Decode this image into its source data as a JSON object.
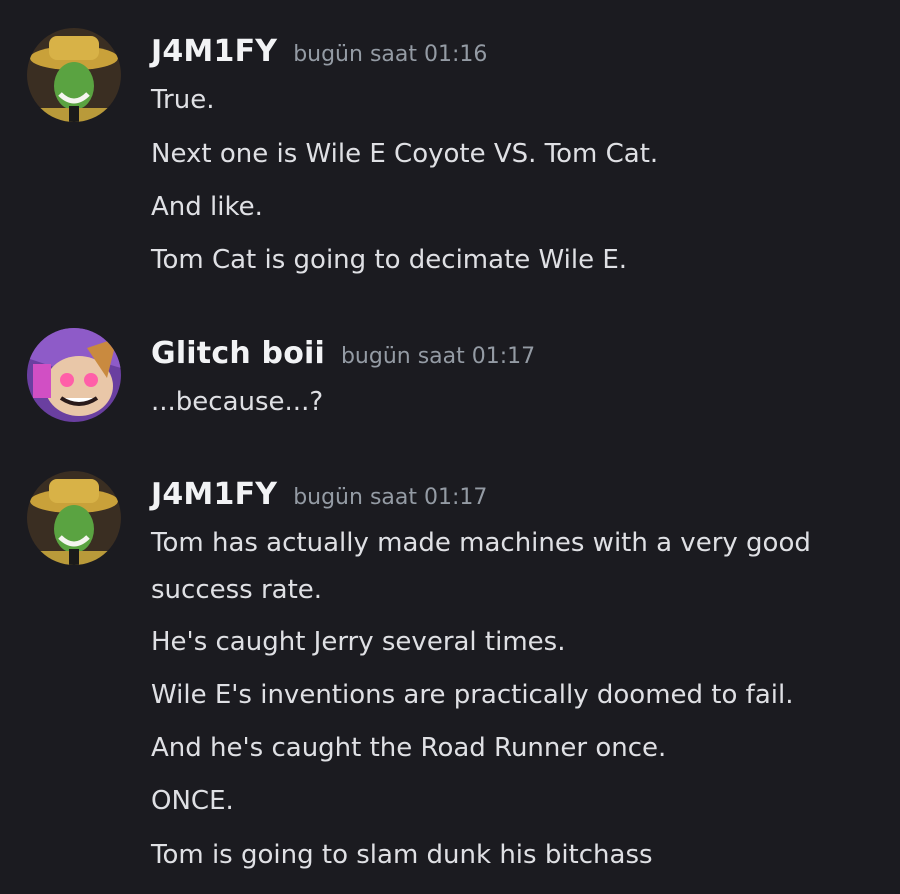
{
  "messages": [
    {
      "author": "J4M1FY",
      "time": "bugün saat 01:16",
      "lines": [
        "True.",
        "Next one is Wile E Coyote VS. Tom Cat.",
        "And like.",
        "Tom Cat is going to decimate Wile E."
      ]
    },
    {
      "author": "Glitch boii",
      "time": "bugün saat 01:17",
      "lines": [
        "...because...?"
      ]
    },
    {
      "author": "J4M1FY",
      "time": "bugün saat 01:17",
      "lines": [
        "Tom has actually made machines with a very good",
        "success rate.",
        "He's caught Jerry several times.",
        "Wile E's inventions are practically doomed to fail.",
        "And he's caught the Road Runner once.",
        "ONCE.",
        "Tom is going to slam dunk his bitchass"
      ]
    }
  ]
}
